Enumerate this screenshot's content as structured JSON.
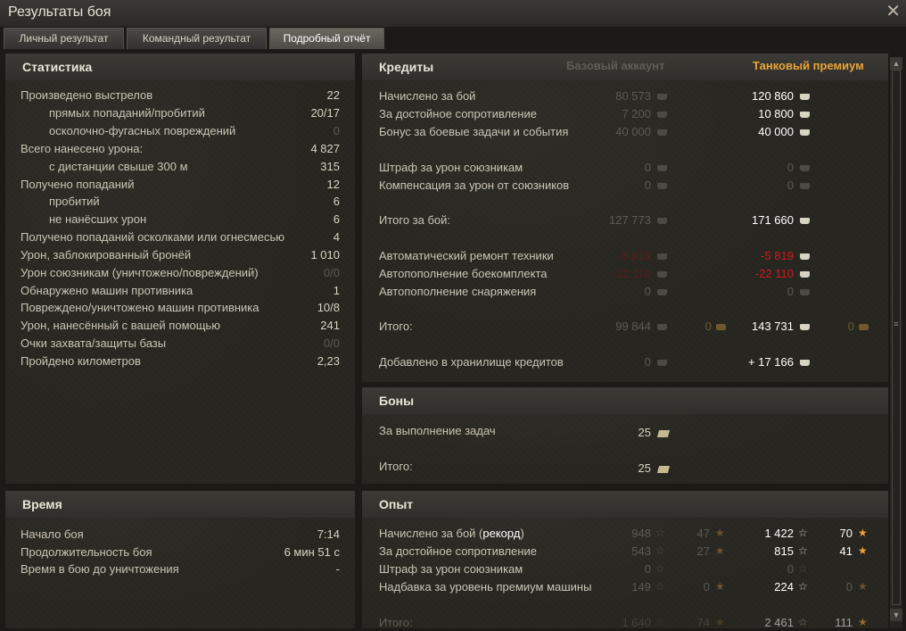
{
  "window": {
    "title": "Результаты боя"
  },
  "tabs": [
    "Личный результат",
    "Командный результат",
    "Подробный отчёт"
  ],
  "stats": {
    "header": "Статистика",
    "rows": [
      {
        "label": "Произведено выстрелов",
        "value": "22"
      },
      {
        "label": "прямых попаданий/пробитий",
        "value": "20/17"
      },
      {
        "label": "осколочно-фугасных повреждений",
        "value": "0"
      },
      {
        "label": "Всего нанесено урона:",
        "value": "4 827"
      },
      {
        "label": "с дистанции свыше 300 м",
        "value": "315"
      },
      {
        "label": "Получено попаданий",
        "value": "12"
      },
      {
        "label": "пробитий",
        "value": "6"
      },
      {
        "label": "не нанёсших урон",
        "value": "6"
      },
      {
        "label": "Получено попаданий осколками или огнесмесью",
        "value": "4"
      },
      {
        "label": "Урон, заблокированный бронёй",
        "value": "1 010"
      },
      {
        "label": "Урон союзникам (уничтожено/повреждений)",
        "value": "0/0"
      },
      {
        "label": "Обнаружено машин противника",
        "value": "1"
      },
      {
        "label": "Повреждено/уничтожено машин противника",
        "value": "10/8"
      },
      {
        "label": "Урон, нанесённый с вашей помощью",
        "value": "241"
      },
      {
        "label": "Очки захвата/защиты базы",
        "value": "0/0"
      },
      {
        "label": "Пройдено километров",
        "value": "2,23"
      }
    ]
  },
  "time": {
    "header": "Время",
    "rows": [
      {
        "label": "Начало боя",
        "value": "7:14"
      },
      {
        "label": "Продолжительность боя",
        "value": "6 мин 51 с"
      },
      {
        "label": "Время в бою до уничтожения",
        "value": "-"
      }
    ]
  },
  "credits": {
    "header": "Кредиты",
    "col_base": "Базовый аккаунт",
    "col_premium": "Танковый премиум",
    "rows": [
      {
        "label": "Начислено за бой",
        "base": "80 573",
        "prem": "120 860"
      },
      {
        "label": "За достойное сопротивление",
        "base": "7 200",
        "prem": "10 800"
      },
      {
        "label": "Бонус за боевые задачи и события",
        "base": "40 000",
        "prem": "40 000"
      },
      {
        "label": "Штраф за урон союзникам",
        "base": "0",
        "prem": "0"
      },
      {
        "label": "Компенсация за урон от союзников",
        "base": "0",
        "prem": "0"
      },
      {
        "label": "Итого за бой:",
        "base": "127 773",
        "prem": "171 660"
      },
      {
        "label": "Автоматический ремонт техники",
        "base": "-5 819",
        "prem": "-5 819"
      },
      {
        "label": "Автопополнение боекомплекта",
        "base": "-22 110",
        "prem": "-22 110"
      },
      {
        "label": "Автопополнение снаряжения",
        "base": "0",
        "prem": "0"
      },
      {
        "label": "Итого:",
        "base": "99 844",
        "base_gold": "0",
        "prem": "143 731",
        "prem_gold": "0"
      },
      {
        "label": "Добавлено в хранилище кредитов",
        "base": "0",
        "prem": "+ 17 166"
      }
    ]
  },
  "bonds": {
    "header": "Боны",
    "rows": [
      {
        "label": "За выполнение задач",
        "value": "25"
      },
      {
        "label": "Итого:",
        "value": "25"
      }
    ]
  },
  "experience": {
    "header": "Опыт",
    "rows": [
      {
        "label": "Начислено за бой (",
        "label_bold": "рекорд",
        "label_end": ")",
        "base": "948",
        "base_free": "47",
        "prem": "1 422",
        "prem_free": "70"
      },
      {
        "label": "За достойное сопротивление",
        "base": "543",
        "base_free": "27",
        "prem": "815",
        "prem_free": "41"
      },
      {
        "label": "Штраф за урон союзникам",
        "base": "0",
        "prem": "0"
      },
      {
        "label": "Надбавка за уровень премиум машины",
        "base": "149",
        "base_free": "0",
        "prem": "224",
        "prem_free": "0"
      },
      {
        "label": "Итого:",
        "base": "1 640",
        "base_free": "74",
        "prem": "2 461",
        "prem_free": "111"
      }
    ]
  },
  "colors": {
    "accent_premium": "#e8a43a",
    "penalty_red": "#cc1d1d"
  }
}
